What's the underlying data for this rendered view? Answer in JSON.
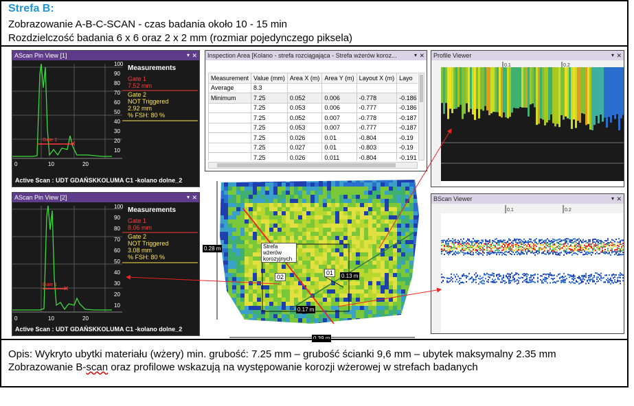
{
  "header": {
    "title": "Strefa B:",
    "line1": "Zobrazowanie A-B-C-SCAN - czas badania około 10 - 15 min",
    "line2": "Rozdzielczość badania 6 x 6 oraz 2 x 2 mm (rozmiar pojedynczego piksela)"
  },
  "ascan1": {
    "title": "AScan Pin View [1]",
    "measurements": "Measurements",
    "gate1": "Gate 1",
    "gate1_value": "7.52 mm",
    "gate2": "Gate 2",
    "gate2_status": "NOT Triggered",
    "gate2_value": "2.92 mm",
    "fsh": "% FSH: 80 %",
    "active_scan": "Active Scan :  UDT GDAŃSKKOLUMA C1  -kolano dolne_2",
    "gate_label": "Gate 1"
  },
  "ascan2": {
    "title": "AScan Pin View [2]",
    "measurements": "Measurements",
    "gate1": "Gate 1",
    "gate1_value": "8.06 mm",
    "gate2": "Gate 2",
    "gate2_status": "NOT Triggered",
    "gate2_value": "3.08 mm",
    "fsh": "% FSH: 80 %",
    "active_scan": "Active Scan :  UDT GDAŃSKKOLUMA C1  -kolano dolne_2",
    "gate_label": "Gate 1"
  },
  "yticks": [
    "100",
    "90",
    "80",
    "70",
    "60",
    "50",
    "40",
    "30",
    "20",
    "10"
  ],
  "xticks": [
    "0",
    "10",
    "20"
  ],
  "inspection": {
    "title": "Inspection Area [Kolano - strefa rozciągająca - Strefa wżerów koroz...",
    "columns": [
      "Measurement",
      "Value (mm)",
      "Area X (m)",
      "Area Y (m)",
      "Layout X (m)",
      "Layo"
    ],
    "rows": [
      [
        "Average",
        "8.3",
        "",
        "",
        "",
        ""
      ],
      [
        "Minimum",
        "7.25",
        "0.052",
        "0.006",
        "-0.778",
        "-0.186"
      ],
      [
        "",
        "7.25",
        "0.053",
        "0.006",
        "-0.777",
        "-0.186"
      ],
      [
        "",
        "7.25",
        "0.052",
        "0.007",
        "-0.778",
        "-0.187"
      ],
      [
        "",
        "7.25",
        "0.053",
        "0.007",
        "-0.777",
        "-0.187"
      ],
      [
        "",
        "7.25",
        "0.026",
        "0.01",
        "-0.804",
        "-0.19"
      ],
      [
        "",
        "7.25",
        "0.027",
        "0.01",
        "-0.803",
        "-0.19"
      ],
      [
        "",
        "7.25",
        "0.026",
        "0.011",
        "-0.804",
        "-0.191"
      ]
    ]
  },
  "profile": {
    "title": "Profile Viewer",
    "ticks": [
      "0.1",
      "0.2"
    ]
  },
  "bscan": {
    "title": "BScan Viewer",
    "ticks": [
      "0.1",
      "0.2"
    ]
  },
  "cscan": {
    "zone_label": "Strefa wżerów korozyjnych",
    "h_label": "0.28 m",
    "w_label": "0.39 m",
    "d1": "0.13 m",
    "d2": "0.17 m",
    "p1": "01",
    "p2": "02"
  },
  "footer": {
    "line1": "Opis: Wykryto ubytki materiału (wżery) min. grubość: 7.25 mm – grubość ścianki 9,6 mm – ubytek maksymalny 2.35 mm",
    "line2a": "Zobrazowanie B-",
    "line2b": "scan",
    "line2c": " oraz profilowe wskazują na występowanie korozji wżerowej w strefach badanych"
  },
  "colors": {
    "title_blue": "#1e96d6",
    "window_title": "#5f3b8c",
    "gate_red": "#ff3b3b",
    "gate_yellow": "#ffe54c",
    "signal": "#3ddc3d"
  }
}
